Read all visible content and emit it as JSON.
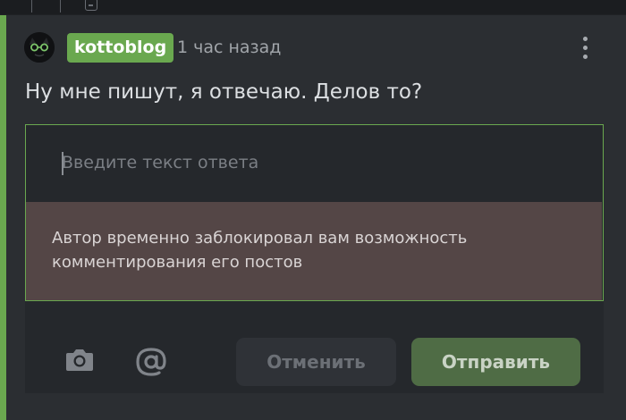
{
  "comment": {
    "author": "kottoblog",
    "timestamp": "1 час назад",
    "text": "Ну мне пишут, я отвечаю. Делов то?"
  },
  "reply": {
    "placeholder": "Введите текст ответа",
    "value": "",
    "blocked_notice_line1": "Автор временно заблокировал вам возможность",
    "blocked_notice_line2": "комментирования его постов"
  },
  "actions": {
    "camera_icon": "camera-icon",
    "mention_icon": "at-sign-icon",
    "cancel_label": "Отменить",
    "submit_label": "Отправить"
  },
  "colors": {
    "accent": "#6aa84f",
    "background": "#2b2e32",
    "blocked_notice_bg": "#544646",
    "submit_bg": "#4f6c45"
  }
}
